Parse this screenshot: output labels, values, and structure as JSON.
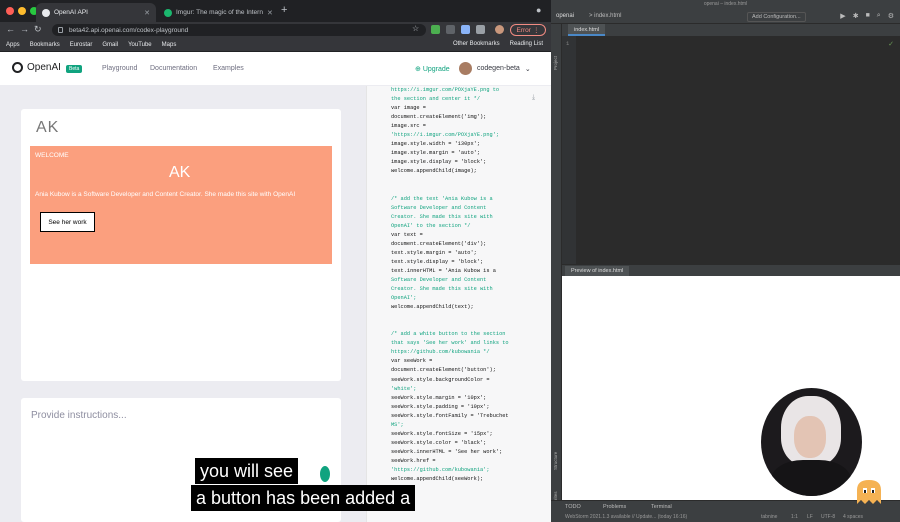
{
  "browser": {
    "tabs": [
      {
        "title": "OpenAI API",
        "active": true
      },
      {
        "title": "Imgur: The magic of the Intern",
        "active": false
      }
    ],
    "url": "beta42.api.openai.com/codex-playground",
    "error_button": "Error",
    "bookmarks": [
      "Apps",
      "Bookmarks",
      "Eurostar",
      "Gmail",
      "YouTube",
      "Maps"
    ],
    "bookmarks_right": [
      "Other Bookmarks",
      "Reading List"
    ]
  },
  "openai": {
    "logo": "OpenAI",
    "beta": "Beta",
    "nav": [
      "Playground",
      "Documentation",
      "Examples"
    ],
    "upgrade": "Upgrade",
    "user": "codegen-beta"
  },
  "preview": {
    "logo": "AK",
    "welcome_title": "WELCOME",
    "welcome_logo": "AK",
    "description": "Ania Kubow is a Software Developer and Content Creator. She made this site with OpenAI",
    "button": "See her work"
  },
  "instructions": {
    "placeholder": "Provide instructions..."
  },
  "code_lines": [
    {
      "t": "https://i.imgur.com/POXjaYE.png to",
      "c": "c"
    },
    {
      "t": "the section and center it */",
      "c": "c"
    },
    {
      "t": "var image =",
      "c": ""
    },
    {
      "t": "document.createElement('img');",
      "c": ""
    },
    {
      "t": "image.src =",
      "c": ""
    },
    {
      "t": "'https://i.imgur.com/POXjaYE.png';",
      "c": "s"
    },
    {
      "t": "image.style.width = '130px';",
      "c": ""
    },
    {
      "t": "image.style.margin = 'auto';",
      "c": ""
    },
    {
      "t": "image.style.display = 'block';",
      "c": ""
    },
    {
      "t": "welcome.appendChild(image);",
      "c": ""
    },
    {
      "t": "",
      "c": ""
    },
    {
      "t": "",
      "c": ""
    },
    {
      "t": "/* add the text 'Ania Kubow is a",
      "c": "c"
    },
    {
      "t": "Software Developer and Content",
      "c": "c"
    },
    {
      "t": "Creator. She made this site with",
      "c": "c"
    },
    {
      "t": "OpenAI' to the section */",
      "c": "c"
    },
    {
      "t": "var text =",
      "c": ""
    },
    {
      "t": "document.createElement('div');",
      "c": ""
    },
    {
      "t": "text.style.margin = 'auto';",
      "c": ""
    },
    {
      "t": "text.style.display = 'block';",
      "c": ""
    },
    {
      "t": "text.innerHTML = 'Ania Kubow is a",
      "c": ""
    },
    {
      "t": "Software Developer and Content",
      "c": "s"
    },
    {
      "t": "Creator. She made this site with",
      "c": "s"
    },
    {
      "t": "OpenAI';",
      "c": "s"
    },
    {
      "t": "welcome.appendChild(text);",
      "c": ""
    },
    {
      "t": "",
      "c": ""
    },
    {
      "t": "",
      "c": ""
    },
    {
      "t": "/* add a white button to the section",
      "c": "c"
    },
    {
      "t": "that says 'See her work' and links to",
      "c": "c"
    },
    {
      "t": "https://github.com/kubowania */",
      "c": "c"
    },
    {
      "t": "var seeWork =",
      "c": ""
    },
    {
      "t": "document.createElement('button');",
      "c": ""
    },
    {
      "t": "seeWork.style.backgroundColor =",
      "c": ""
    },
    {
      "t": "'white';",
      "c": "s"
    },
    {
      "t": "seeWork.style.margin = '10px';",
      "c": ""
    },
    {
      "t": "seeWork.style.padding = '10px';",
      "c": ""
    },
    {
      "t": "seeWork.style.fontFamily = 'Trebuchet",
      "c": ""
    },
    {
      "t": "MS';",
      "c": "s"
    },
    {
      "t": "seeWork.style.fontSize = '15px';",
      "c": ""
    },
    {
      "t": "seeWork.style.color = 'black';",
      "c": ""
    },
    {
      "t": "seeWork.innerHTML = 'See her work';",
      "c": ""
    },
    {
      "t": "seeWork.href =",
      "c": ""
    },
    {
      "t": "'https://github.com/kubowania';",
      "c": "s"
    },
    {
      "t": "welcome.appendChild(seeWork);",
      "c": ""
    }
  ],
  "ide": {
    "window_title": "openai – index.html",
    "project": "openai",
    "file": "index.html",
    "add_config": "Add Configuration...",
    "editor_tab": "index.html",
    "line_number": "1",
    "preview_tab": "Preview of index.html",
    "side_labels": [
      "Project",
      "Structure",
      "Favorites"
    ],
    "bottom_tools": [
      "TODO",
      "Problems",
      "Terminal"
    ],
    "status_left": "WebStorm 2021.1.3 available // Update... (today 16:16)",
    "status_right": [
      "tabnine",
      "1:1",
      "LF",
      "UTF-8",
      "4 spaces"
    ]
  },
  "captions": [
    "you will see",
    "a button has been added a"
  ]
}
